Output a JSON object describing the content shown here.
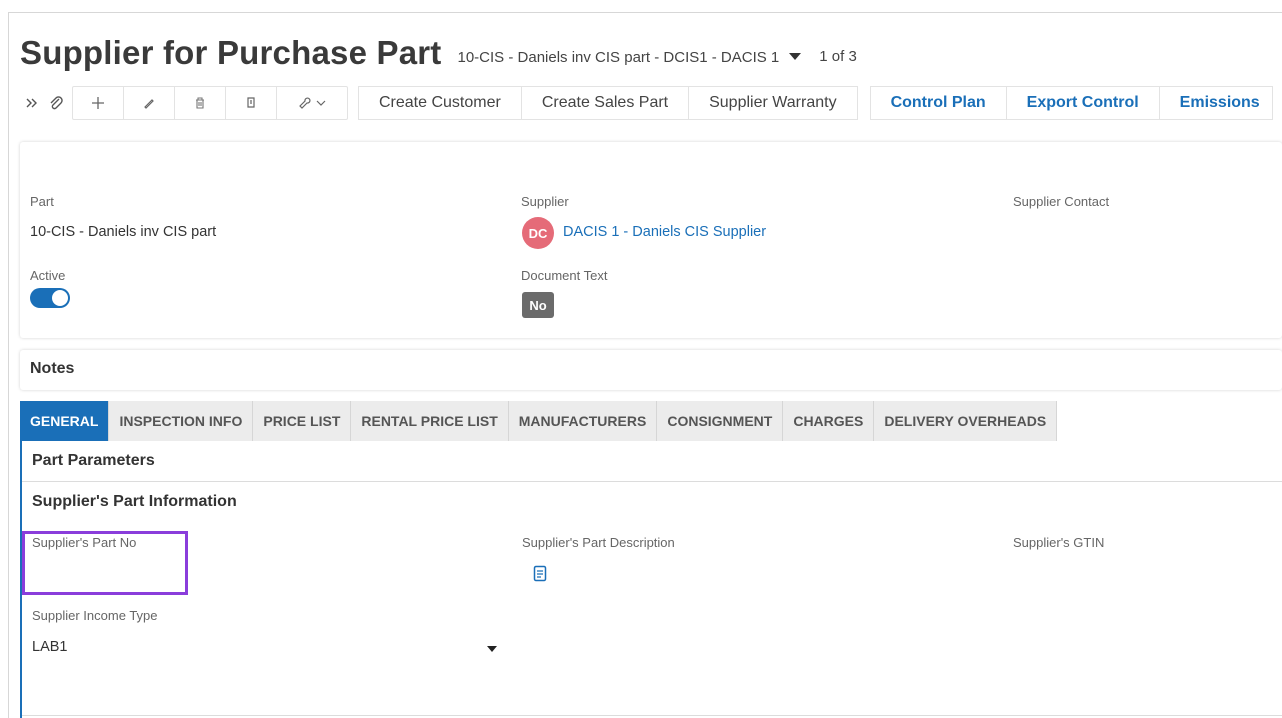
{
  "header": {
    "title": "Supplier for Purchase Part",
    "record_key": "10-CIS - Daniels inv CIS part - DCIS1 - DACIS 1",
    "record_count": "1 of 3"
  },
  "toolbar": {
    "icons": [
      "expand-icon",
      "attachment-icon",
      "add-icon",
      "edit-icon",
      "delete-icon",
      "copy-icon",
      "tools-icon"
    ],
    "text_buttons": [
      "Create Customer",
      "Create Sales Part",
      "Supplier Warranty"
    ],
    "link_buttons": [
      "Control Plan",
      "Export Control",
      "Emissions"
    ]
  },
  "info": {
    "part_label": "Part",
    "part_value": "10-CIS - Daniels inv CIS part",
    "supplier_label": "Supplier",
    "supplier_avatar": "DC",
    "supplier_value": "DACIS 1 - Daniels CIS Supplier",
    "supplier_contact_label": "Supplier Contact",
    "active_label": "Active",
    "active_value": true,
    "document_text_label": "Document Text",
    "document_text_value": "No"
  },
  "notes": {
    "title": "Notes"
  },
  "tabs": [
    {
      "label": "GENERAL",
      "active": true
    },
    {
      "label": "INSPECTION INFO",
      "active": false
    },
    {
      "label": "PRICE LIST",
      "active": false
    },
    {
      "label": "RENTAL PRICE LIST",
      "active": false
    },
    {
      "label": "MANUFACTURERS",
      "active": false
    },
    {
      "label": "CONSIGNMENT",
      "active": false
    },
    {
      "label": "CHARGES",
      "active": false
    },
    {
      "label": "DELIVERY OVERHEADS",
      "active": false
    }
  ],
  "general": {
    "part_parameters_title": "Part Parameters",
    "supplier_part_info_title": "Supplier's Part Information",
    "supplier_part_no_label": "Supplier's Part No",
    "supplier_part_no_value": "",
    "supplier_part_desc_label": "Supplier's Part Description",
    "supplier_gtin_label": "Supplier's GTIN",
    "supplier_income_type_label": "Supplier Income Type",
    "supplier_income_type_value": "LAB1"
  },
  "colors": {
    "accent": "#1a6fb8",
    "avatar": "#e56b78",
    "highlight": "#8a3ddb",
    "badge": "#6b6b6b"
  }
}
